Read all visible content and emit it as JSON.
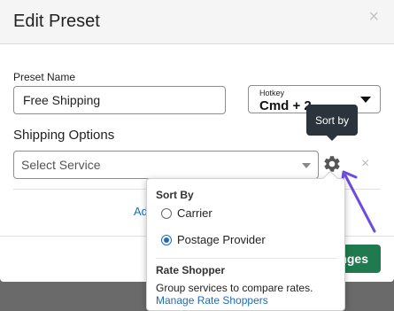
{
  "modal": {
    "title": "Edit Preset",
    "close_glyph": "×"
  },
  "preset_name": {
    "label": "Preset Name",
    "value": "Free Shipping"
  },
  "hotkey": {
    "label": "Hotkey",
    "value": "Cmd + 2"
  },
  "shipping_options": {
    "title": "Shipping Options",
    "select_placeholder": "Select Service",
    "remove_glyph": "×",
    "gear_icon": "gear-icon"
  },
  "add_link": "Ad",
  "save_button": "nges",
  "tooltip": "Sort by",
  "sort_popover": {
    "heading": "Sort By",
    "options": [
      {
        "label": "Carrier",
        "checked": false
      },
      {
        "label": "Postage Provider",
        "checked": true
      }
    ],
    "rate_shopper_heading": "Rate Shopper",
    "rate_shopper_desc": "Group services to compare rates.",
    "rate_shopper_link": "Manage Rate Shoppers"
  },
  "colors": {
    "accent_link": "#1e6bb8",
    "save_green": "#1f7a4f",
    "annotation_arrow": "#6c4ce0",
    "tooltip_bg": "#2b343c"
  }
}
